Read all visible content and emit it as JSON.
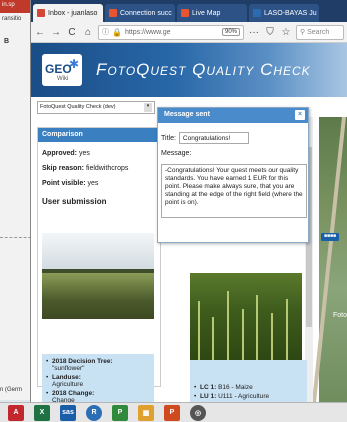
{
  "background_window": {
    "red_label": "in.sp",
    "line1": "ransitio",
    "line2": "B",
    "bottom": "n (Germ"
  },
  "browser": {
    "tabs": [
      {
        "label": "Inbox - juanlaso",
        "color": "#d44638"
      },
      {
        "label": "Connection succ",
        "color": "#e8542f"
      },
      {
        "label": "Live Map",
        "color": "#e8542f"
      },
      {
        "label": "LASO-BAYAS Ju",
        "color": "#2b6cb0"
      }
    ],
    "nav": {
      "back": "←",
      "forward": "→",
      "reload": "C",
      "home": "⌂"
    },
    "url": "https://www.ge",
    "zoom": "90%",
    "more": "···",
    "search_placeholder": "Search"
  },
  "page": {
    "logo": {
      "text": "GEO",
      "sub": "Wiki"
    },
    "title": "FotoQuest Quality Check",
    "select_value": "FotoQuest Quality Check (dev)",
    "map_sign": "■■■■",
    "map_label": "Foto"
  },
  "comparison": {
    "header": "Comparison",
    "approved_label": "Approved:",
    "approved_value": "yes",
    "skip_label": "Skip reason:",
    "skip_value": "fieldwithcrops",
    "point_label": "Point visible:",
    "point_value": "yes",
    "user_submission": "User submission",
    "left_info": [
      {
        "label": "2018 Decision Tree:",
        "value": "\"sunflower\""
      },
      {
        "label": "Landuse:",
        "value": "Agriculture"
      },
      {
        "label": "2018 Change:",
        "value": "Change"
      }
    ],
    "right_info": [
      {
        "label": "LC 1:",
        "value": "B16 - Maize"
      },
      {
        "label": "LU 1:",
        "value": "U111 - Agriculture"
      }
    ]
  },
  "popup": {
    "header": "Message sent",
    "close": "×",
    "title_label": "Title:",
    "title_value": "Congratulations!",
    "message_label": "Message:",
    "message_value": "-Congratulations! Your quest meets our quality standards. You have earned 1 EUR for this point. Please make always sure, that you are standing at the edge of the right field (where the point is on)."
  },
  "taskbar": [
    {
      "name": "acrobat",
      "label": "A",
      "color": "#c2272d"
    },
    {
      "name": "excel",
      "label": "X",
      "color": "#1f7244"
    },
    {
      "name": "sas",
      "label": "sas",
      "color": "#1b5ea8"
    },
    {
      "name": "r",
      "label": "R",
      "color": "#2c6eb5"
    },
    {
      "name": "project",
      "label": "P",
      "color": "#2f8a3b"
    },
    {
      "name": "apps",
      "label": "▦",
      "color": "#e0a030"
    },
    {
      "name": "powerpoint",
      "label": "P",
      "color": "#d04a20"
    },
    {
      "name": "chrome",
      "label": "◎",
      "color": "#555555"
    }
  ]
}
